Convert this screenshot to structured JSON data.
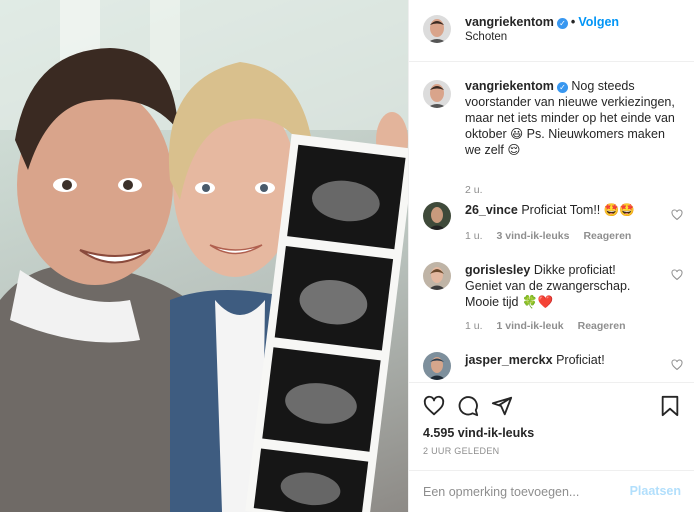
{
  "post": {
    "username": "vangriekentom",
    "verified_icon": "verified-badge-icon",
    "follow_label": "Volgen",
    "separator": "•",
    "location": "Schoten"
  },
  "caption": {
    "username": "vangriekentom",
    "text": "Nog steeds voorstander van nieuwe verkiezingen, maar net iets minder op het einde van oktober 😃 Ps. Nieuwkomers maken we zelf 😌",
    "time": "2 u."
  },
  "comments": [
    {
      "username": "26_vince",
      "text": "Proficiat Tom!! 🤩🤩",
      "time": "1 u.",
      "likes": "3 vind-ik-leuks",
      "reply": "Reageren"
    },
    {
      "username": "gorislesley",
      "text": "Dikke proficiat! Geniet van de zwangerschap. Mooie tijd 🍀❤️",
      "time": "1 u.",
      "likes": "1 vind-ik-leuk",
      "reply": "Reageren"
    },
    {
      "username": "jasper_merckx",
      "text": "Proficiat!"
    }
  ],
  "actions": {
    "likes": "4.595 vind-ik-leuks",
    "posted": "2 UUR GELEDEN"
  },
  "add_comment": {
    "placeholder": "Een opmerking toevoegen...",
    "post_label": "Plaatsen"
  },
  "icons": {
    "like": "heart-icon",
    "comment": "comment-icon",
    "share": "share-icon",
    "save": "bookmark-icon"
  },
  "colors": {
    "accent": "#0095f6",
    "verified": "#3897f0",
    "post_disabled": "#b2dffc",
    "muted": "#8e8e8e",
    "text": "#262626"
  }
}
